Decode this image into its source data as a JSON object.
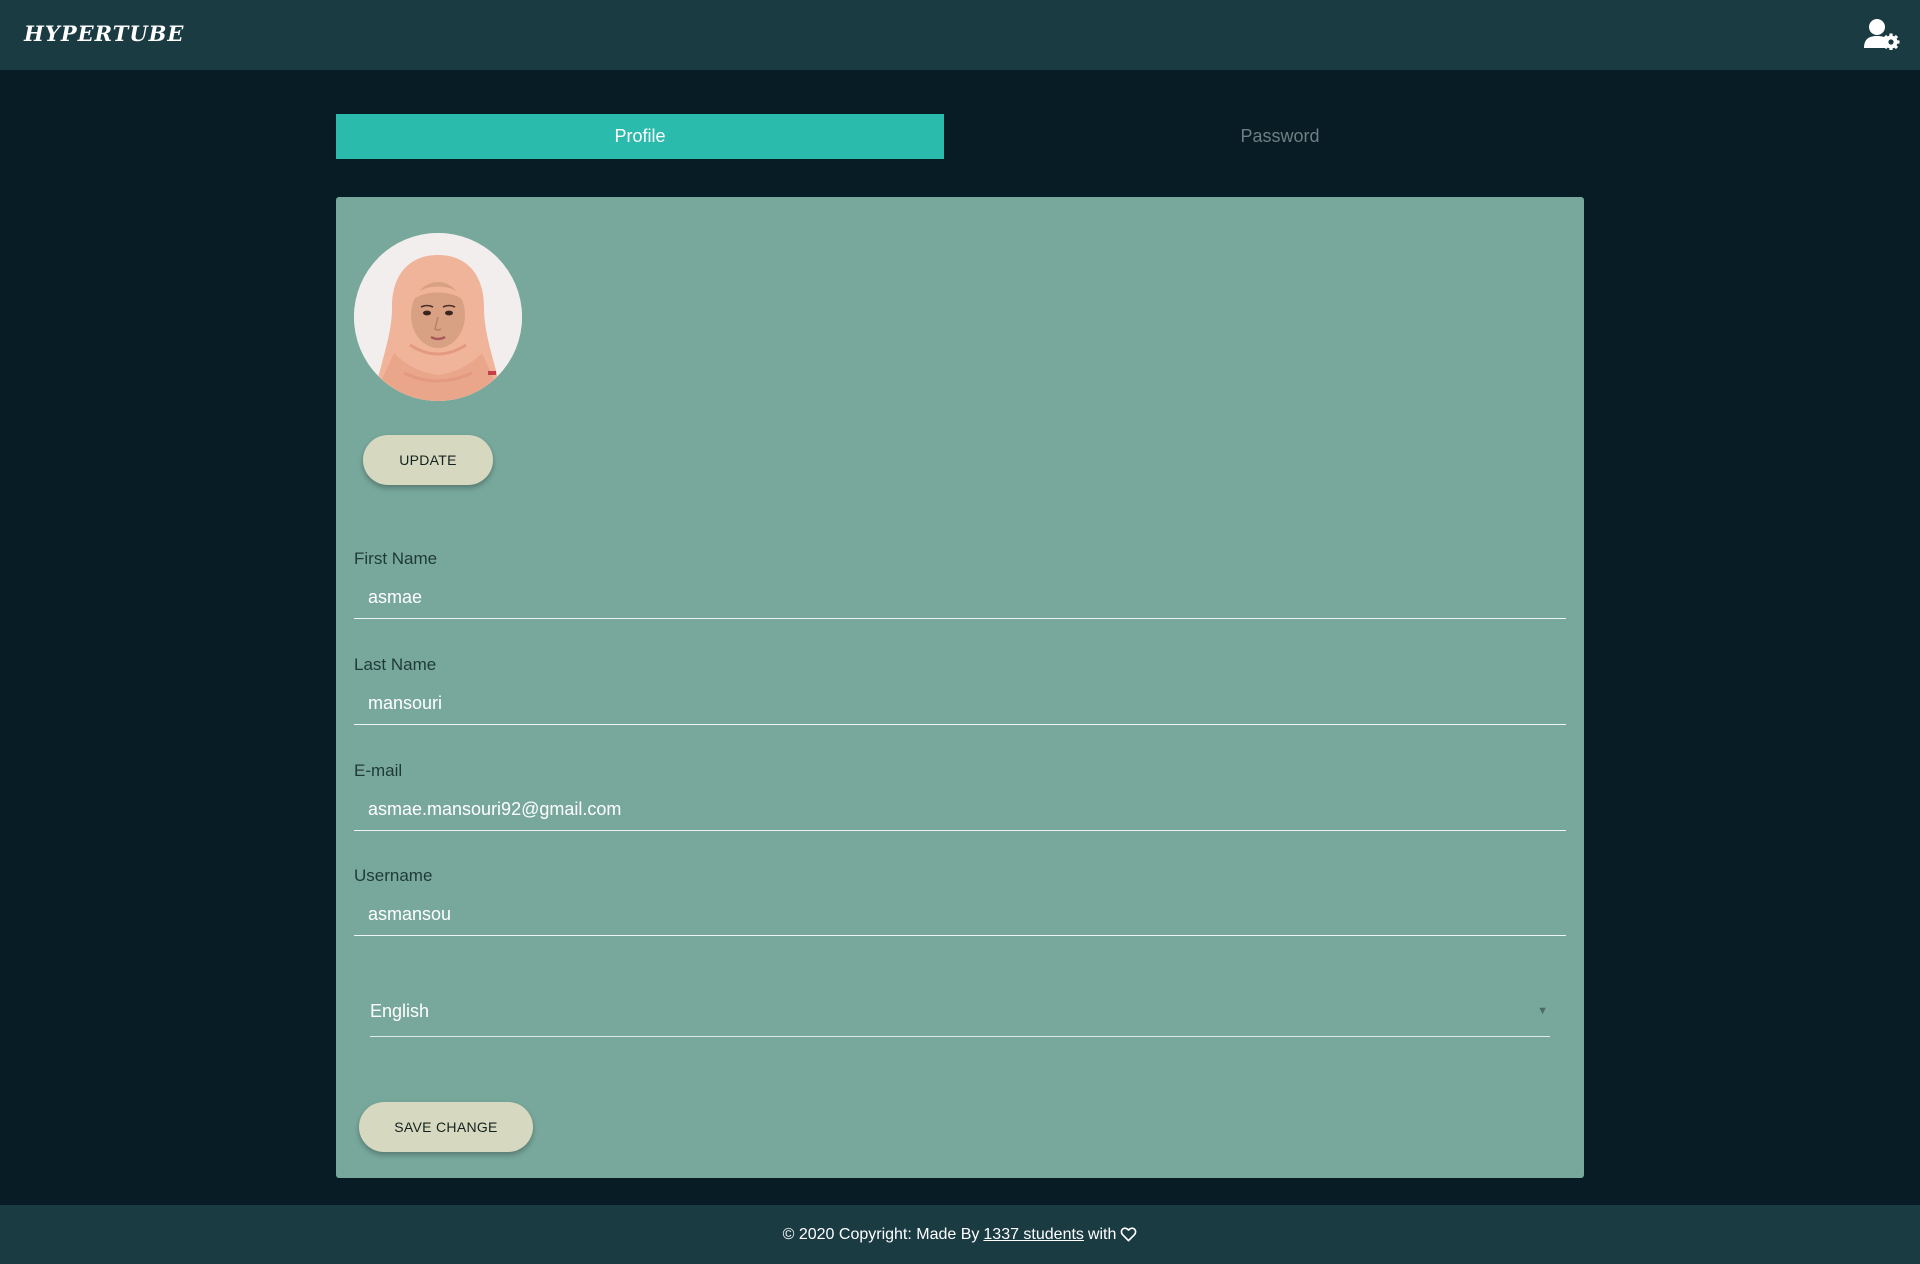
{
  "header": {
    "brand": "HYPERTUBE",
    "account_icon": "user-cog-icon"
  },
  "tabs": [
    {
      "label": "Profile",
      "active": true
    },
    {
      "label": "Password",
      "active": false
    }
  ],
  "profile": {
    "avatar_icon": "profile-photo",
    "update_label": "UPDATE",
    "fields": [
      {
        "label": "First Name",
        "value": "asmae"
      },
      {
        "label": "Last Name",
        "value": "mansouri"
      },
      {
        "label": "E-mail",
        "value": "asmae.mansouri92@gmail.com"
      },
      {
        "label": "Username",
        "value": "asmansou"
      }
    ],
    "language": {
      "selected": "English",
      "caret_icon": "caret-down-icon"
    },
    "save_label": "SAVE CHANGE"
  },
  "footer": {
    "prefix": "© 2020 Copyright: Made By",
    "link": "1337 students",
    "suffix": "with",
    "heart_icon": "heart-icon"
  },
  "colors": {
    "page_bg": "#071c24",
    "header_bg": "#1b3b43",
    "tab_active": "#2bbbad",
    "card_bg": "#78a89c",
    "button_bg": "#d6d9c0"
  }
}
